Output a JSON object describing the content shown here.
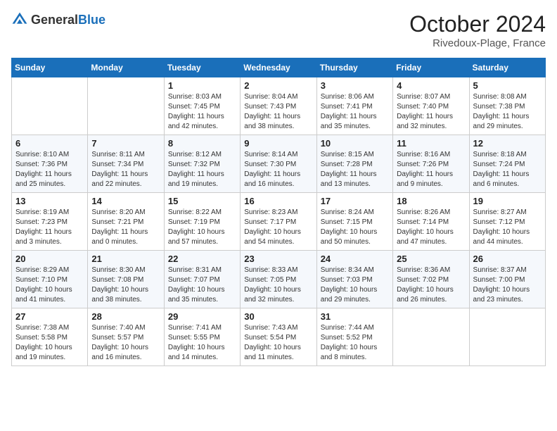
{
  "header": {
    "logo_general": "General",
    "logo_blue": "Blue",
    "month_title": "October 2024",
    "location": "Rivedoux-Plage, France"
  },
  "days_of_week": [
    "Sunday",
    "Monday",
    "Tuesday",
    "Wednesday",
    "Thursday",
    "Friday",
    "Saturday"
  ],
  "weeks": [
    [
      null,
      null,
      {
        "day": "1",
        "sunrise": "Sunrise: 8:03 AM",
        "sunset": "Sunset: 7:45 PM",
        "daylight": "Daylight: 11 hours and 42 minutes."
      },
      {
        "day": "2",
        "sunrise": "Sunrise: 8:04 AM",
        "sunset": "Sunset: 7:43 PM",
        "daylight": "Daylight: 11 hours and 38 minutes."
      },
      {
        "day": "3",
        "sunrise": "Sunrise: 8:06 AM",
        "sunset": "Sunset: 7:41 PM",
        "daylight": "Daylight: 11 hours and 35 minutes."
      },
      {
        "day": "4",
        "sunrise": "Sunrise: 8:07 AM",
        "sunset": "Sunset: 7:40 PM",
        "daylight": "Daylight: 11 hours and 32 minutes."
      },
      {
        "day": "5",
        "sunrise": "Sunrise: 8:08 AM",
        "sunset": "Sunset: 7:38 PM",
        "daylight": "Daylight: 11 hours and 29 minutes."
      }
    ],
    [
      {
        "day": "6",
        "sunrise": "Sunrise: 8:10 AM",
        "sunset": "Sunset: 7:36 PM",
        "daylight": "Daylight: 11 hours and 25 minutes."
      },
      {
        "day": "7",
        "sunrise": "Sunrise: 8:11 AM",
        "sunset": "Sunset: 7:34 PM",
        "daylight": "Daylight: 11 hours and 22 minutes."
      },
      {
        "day": "8",
        "sunrise": "Sunrise: 8:12 AM",
        "sunset": "Sunset: 7:32 PM",
        "daylight": "Daylight: 11 hours and 19 minutes."
      },
      {
        "day": "9",
        "sunrise": "Sunrise: 8:14 AM",
        "sunset": "Sunset: 7:30 PM",
        "daylight": "Daylight: 11 hours and 16 minutes."
      },
      {
        "day": "10",
        "sunrise": "Sunrise: 8:15 AM",
        "sunset": "Sunset: 7:28 PM",
        "daylight": "Daylight: 11 hours and 13 minutes."
      },
      {
        "day": "11",
        "sunrise": "Sunrise: 8:16 AM",
        "sunset": "Sunset: 7:26 PM",
        "daylight": "Daylight: 11 hours and 9 minutes."
      },
      {
        "day": "12",
        "sunrise": "Sunrise: 8:18 AM",
        "sunset": "Sunset: 7:24 PM",
        "daylight": "Daylight: 11 hours and 6 minutes."
      }
    ],
    [
      {
        "day": "13",
        "sunrise": "Sunrise: 8:19 AM",
        "sunset": "Sunset: 7:23 PM",
        "daylight": "Daylight: 11 hours and 3 minutes."
      },
      {
        "day": "14",
        "sunrise": "Sunrise: 8:20 AM",
        "sunset": "Sunset: 7:21 PM",
        "daylight": "Daylight: 11 hours and 0 minutes."
      },
      {
        "day": "15",
        "sunrise": "Sunrise: 8:22 AM",
        "sunset": "Sunset: 7:19 PM",
        "daylight": "Daylight: 10 hours and 57 minutes."
      },
      {
        "day": "16",
        "sunrise": "Sunrise: 8:23 AM",
        "sunset": "Sunset: 7:17 PM",
        "daylight": "Daylight: 10 hours and 54 minutes."
      },
      {
        "day": "17",
        "sunrise": "Sunrise: 8:24 AM",
        "sunset": "Sunset: 7:15 PM",
        "daylight": "Daylight: 10 hours and 50 minutes."
      },
      {
        "day": "18",
        "sunrise": "Sunrise: 8:26 AM",
        "sunset": "Sunset: 7:14 PM",
        "daylight": "Daylight: 10 hours and 47 minutes."
      },
      {
        "day": "19",
        "sunrise": "Sunrise: 8:27 AM",
        "sunset": "Sunset: 7:12 PM",
        "daylight": "Daylight: 10 hours and 44 minutes."
      }
    ],
    [
      {
        "day": "20",
        "sunrise": "Sunrise: 8:29 AM",
        "sunset": "Sunset: 7:10 PM",
        "daylight": "Daylight: 10 hours and 41 minutes."
      },
      {
        "day": "21",
        "sunrise": "Sunrise: 8:30 AM",
        "sunset": "Sunset: 7:08 PM",
        "daylight": "Daylight: 10 hours and 38 minutes."
      },
      {
        "day": "22",
        "sunrise": "Sunrise: 8:31 AM",
        "sunset": "Sunset: 7:07 PM",
        "daylight": "Daylight: 10 hours and 35 minutes."
      },
      {
        "day": "23",
        "sunrise": "Sunrise: 8:33 AM",
        "sunset": "Sunset: 7:05 PM",
        "daylight": "Daylight: 10 hours and 32 minutes."
      },
      {
        "day": "24",
        "sunrise": "Sunrise: 8:34 AM",
        "sunset": "Sunset: 7:03 PM",
        "daylight": "Daylight: 10 hours and 29 minutes."
      },
      {
        "day": "25",
        "sunrise": "Sunrise: 8:36 AM",
        "sunset": "Sunset: 7:02 PM",
        "daylight": "Daylight: 10 hours and 26 minutes."
      },
      {
        "day": "26",
        "sunrise": "Sunrise: 8:37 AM",
        "sunset": "Sunset: 7:00 PM",
        "daylight": "Daylight: 10 hours and 23 minutes."
      }
    ],
    [
      {
        "day": "27",
        "sunrise": "Sunrise: 7:38 AM",
        "sunset": "Sunset: 5:58 PM",
        "daylight": "Daylight: 10 hours and 19 minutes."
      },
      {
        "day": "28",
        "sunrise": "Sunrise: 7:40 AM",
        "sunset": "Sunset: 5:57 PM",
        "daylight": "Daylight: 10 hours and 16 minutes."
      },
      {
        "day": "29",
        "sunrise": "Sunrise: 7:41 AM",
        "sunset": "Sunset: 5:55 PM",
        "daylight": "Daylight: 10 hours and 14 minutes."
      },
      {
        "day": "30",
        "sunrise": "Sunrise: 7:43 AM",
        "sunset": "Sunset: 5:54 PM",
        "daylight": "Daylight: 10 hours and 11 minutes."
      },
      {
        "day": "31",
        "sunrise": "Sunrise: 7:44 AM",
        "sunset": "Sunset: 5:52 PM",
        "daylight": "Daylight: 10 hours and 8 minutes."
      },
      null,
      null
    ]
  ]
}
